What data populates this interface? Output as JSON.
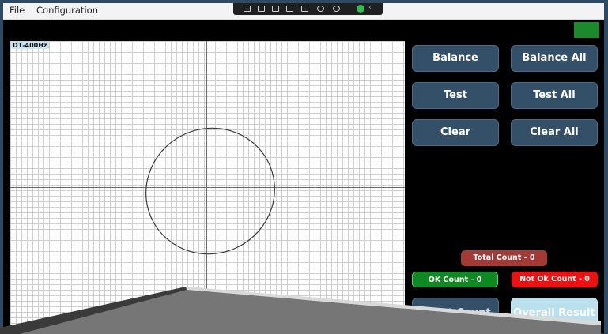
{
  "menu": {
    "file": "File",
    "configuration": "Configuration"
  },
  "toolbar": {
    "icons": [
      "capture-icon",
      "camera-icon",
      "screen-icon",
      "window-icon",
      "mode-icon",
      "audio-icon",
      "help-icon",
      "check-icon",
      "chevron-left-icon"
    ]
  },
  "status": {
    "color": "#1c8a2c"
  },
  "plot": {
    "label": "D1-400Hz"
  },
  "buttons": {
    "balance": "Balance",
    "balance_all": "Balance All",
    "test": "Test",
    "test_all": "Test All",
    "clear": "Clear",
    "clear_all": "Clear All",
    "reset_count": "Reset Count",
    "overall_result": "Overall Result"
  },
  "counts": {
    "total": "Total Count - 0",
    "ok": "OK Count - 0",
    "not_ok": "Not Ok Count - 0"
  },
  "colors": {
    "button": "#335068",
    "total_badge": "#a33a36",
    "ok_badge": "#0f8a22",
    "not_ok_badge": "#ee1111",
    "overall": "#b9e0ec"
  }
}
